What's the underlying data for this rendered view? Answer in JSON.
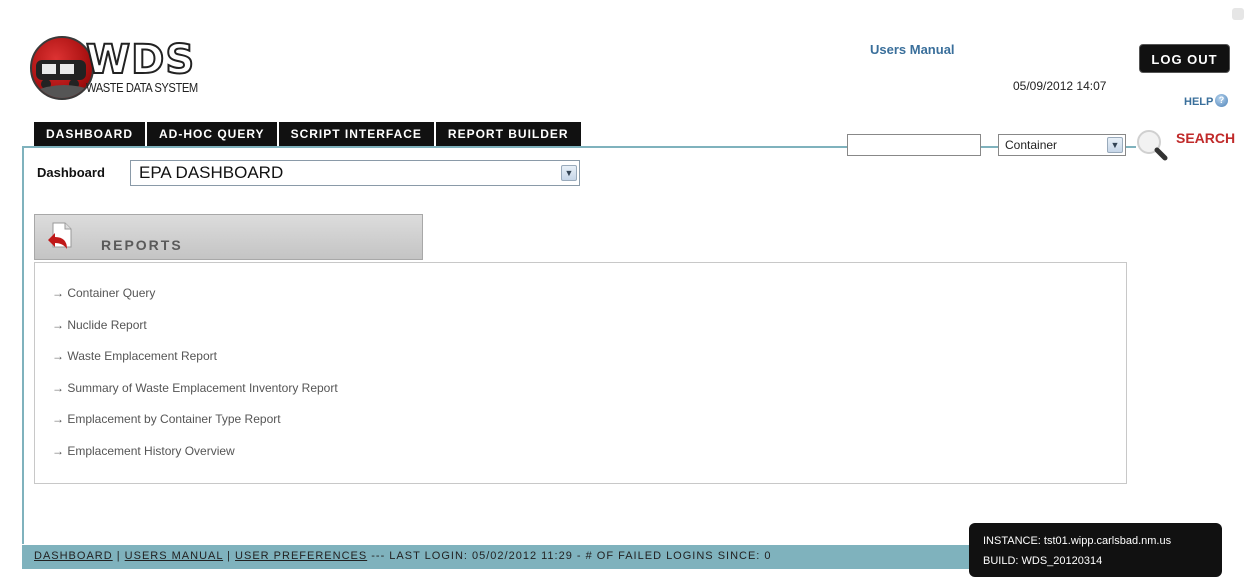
{
  "header": {
    "logo_text": "WDS",
    "logo_subtitle": "WASTE DATA SYSTEM",
    "users_manual": "Users Manual",
    "datetime": "05/09/2012 14:07",
    "logout": "LOG OUT",
    "help": "HELP"
  },
  "nav": {
    "tabs": [
      {
        "label": "DASHBOARD"
      },
      {
        "label": "AD-HOC QUERY"
      },
      {
        "label": "SCRIPT INTERFACE"
      },
      {
        "label": "REPORT BUILDER"
      }
    ]
  },
  "search": {
    "input_value": "",
    "type_selected": "Container",
    "label": "SEARCH"
  },
  "dashboard": {
    "label": "Dashboard",
    "selected": "EPA DASHBOARD"
  },
  "reports": {
    "title": "REPORTS",
    "items": [
      {
        "label": "Container Query"
      },
      {
        "label": "Nuclide Report"
      },
      {
        "label": "Waste Emplacement Report"
      },
      {
        "label": "Summary of Waste Emplacement Inventory Report"
      },
      {
        "label": "Emplacement by Container Type Report"
      },
      {
        "label": "Emplacement History Overview"
      }
    ]
  },
  "footer": {
    "link_dashboard": "DASHBOARD",
    "link_manual": "USERS MANUAL",
    "link_prefs": "USER PREFERENCES",
    "separator": "|",
    "status": "--- LAST LOGIN: 05/02/2012 11:29 - # OF FAILED LOGINS SINCE: 0",
    "instance": "INSTANCE: tst01.wipp.carlsbad.nm.us",
    "build": "BUILD: WDS_20120314"
  },
  "colors": {
    "accent_teal": "#7fb2bd",
    "nav_bg": "#111111",
    "link_blue": "#3a6f9b",
    "search_red": "#c02a2a"
  }
}
